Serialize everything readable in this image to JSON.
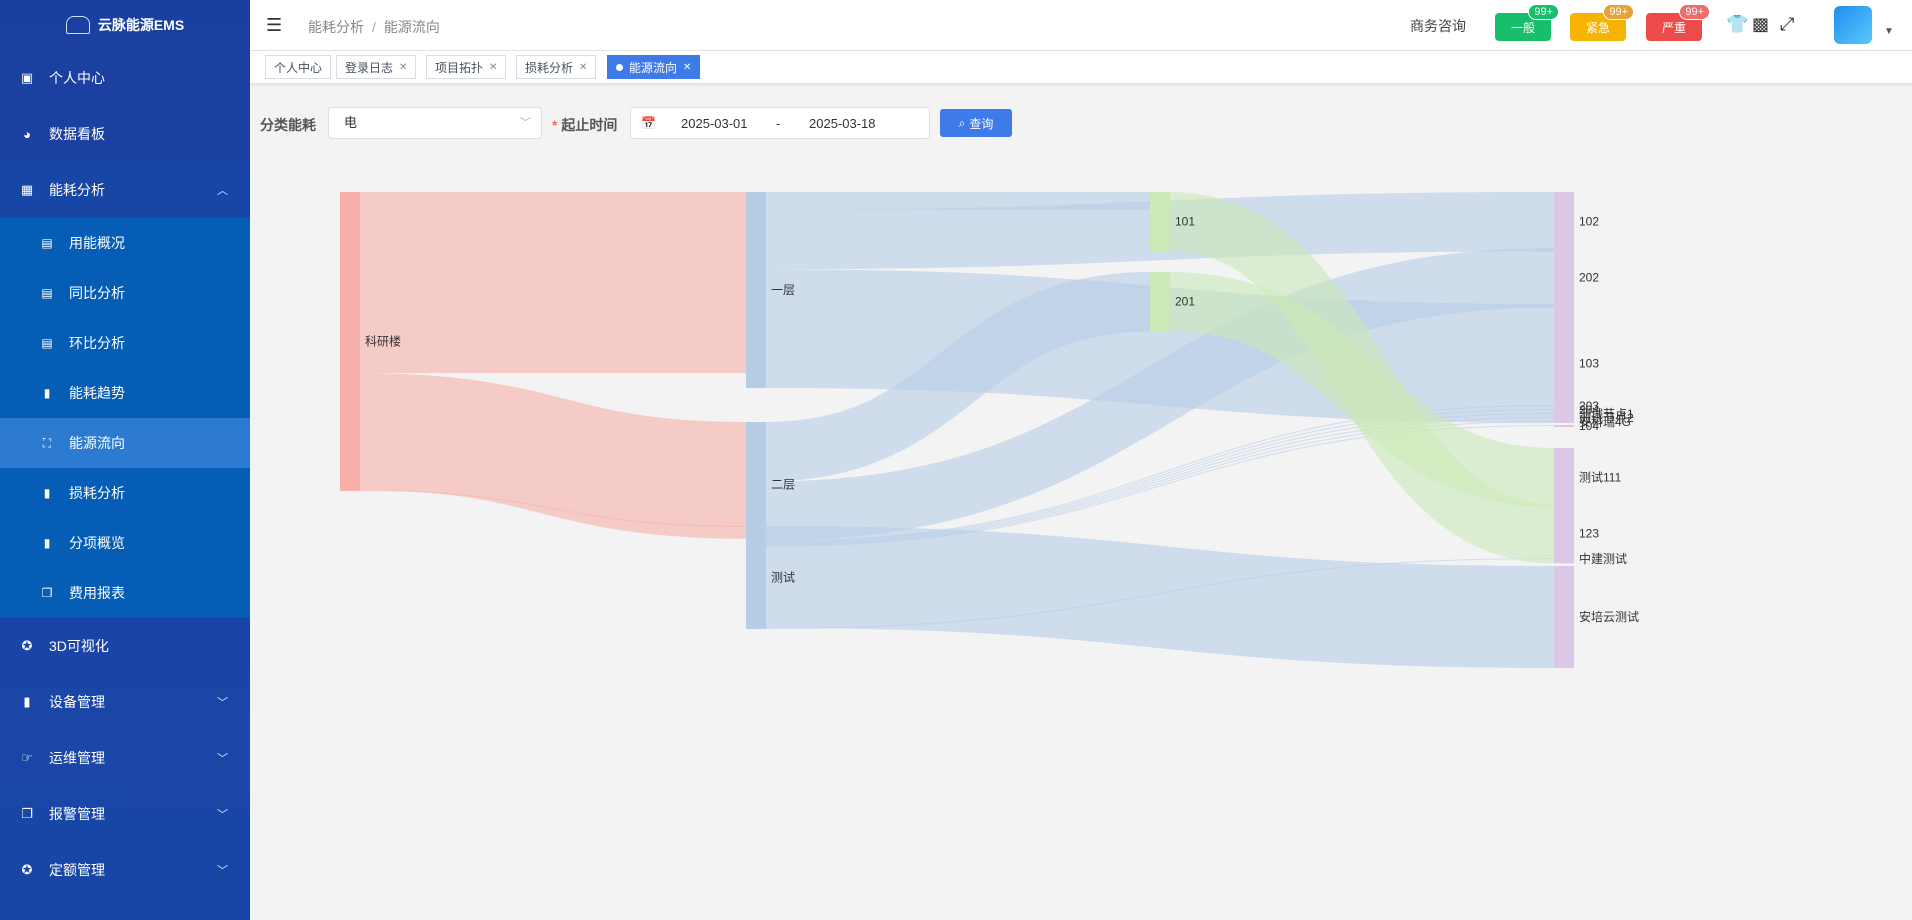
{
  "app": {
    "title": "云脉能源EMS"
  },
  "sidebar": {
    "items": [
      {
        "label": "个人中心",
        "icon": "user-card-icon"
      },
      {
        "label": "数据看板",
        "icon": "dashboard-icon"
      },
      {
        "label": "能耗分析",
        "icon": "table-icon",
        "open": true
      },
      {
        "label": "3D可视化",
        "icon": "cube-icon"
      },
      {
        "label": "设备管理",
        "icon": "bar-chart-icon"
      },
      {
        "label": "运维管理",
        "icon": "hand-icon"
      },
      {
        "label": "报警管理",
        "icon": "copy-icon"
      },
      {
        "label": "定额管理",
        "icon": "target-icon"
      }
    ],
    "sub_items": [
      {
        "label": "用能概况",
        "icon": "grid-icon"
      },
      {
        "label": "同比分析",
        "icon": "grid-icon"
      },
      {
        "label": "环比分析",
        "icon": "grid-icon"
      },
      {
        "label": "能耗趋势",
        "icon": "bar-chart-icon"
      },
      {
        "label": "能源流向",
        "icon": "tree-icon",
        "active": true
      },
      {
        "label": "损耗分析",
        "icon": "bar-chart-icon"
      },
      {
        "label": "分项概览",
        "icon": "bar-chart-icon"
      },
      {
        "label": "费用报表",
        "icon": "copy-icon"
      }
    ]
  },
  "header": {
    "breadcrumb": [
      "能耗分析",
      "能源流向"
    ],
    "consult": "商务咨询",
    "alarms": [
      {
        "label": "一般",
        "count": "99+",
        "color": "#19be6b"
      },
      {
        "label": "紧急",
        "count": "99+",
        "color": "#f6b400"
      },
      {
        "label": "严重",
        "count": "99+",
        "color": "#ed4a4a"
      }
    ]
  },
  "tags": [
    {
      "label": "个人中心",
      "closable": false
    },
    {
      "label": "登录日志",
      "closable": true
    },
    {
      "label": "项目拓扑",
      "closable": true
    },
    {
      "label": "损耗分析",
      "closable": true
    },
    {
      "label": "能源流向",
      "closable": true,
      "active": true
    }
  ],
  "filter": {
    "category_label": "分类能耗",
    "category_value": "电",
    "time_label": "起止时间",
    "required_mark": "*",
    "date_start": "2025-03-01",
    "date_sep": "-",
    "date_end": "2025-03-18",
    "query_label": "查询"
  },
  "chart_data": {
    "type": "sankey",
    "nodes": [
      {
        "name": "科研楼",
        "color": "#f7b0a9"
      },
      {
        "name": "一层",
        "color": "#b7cde6"
      },
      {
        "name": "二层",
        "color": "#b7cde6"
      },
      {
        "name": "测试",
        "color": "#b7cde6"
      },
      {
        "name": "101",
        "color": "#cbeab8"
      },
      {
        "name": "201",
        "color": "#cbeab8"
      },
      {
        "name": "102",
        "color": "#dcc8e6"
      },
      {
        "name": "202",
        "color": "#dcc8e6"
      },
      {
        "name": "103",
        "color": "#dcc8e6"
      },
      {
        "name": "203",
        "color": "#dcc8e6"
      },
      {
        "name": "204",
        "color": "#dcc8e6"
      },
      {
        "name": "测试节点1",
        "color": "#dcc8e6"
      },
      {
        "name": "测试节点2",
        "color": "#dcc8e6"
      },
      {
        "name": "安科瑞4G",
        "color": "#dcc8e6"
      },
      {
        "name": "104",
        "color": "#dcc8e6"
      },
      {
        "name": "测试111",
        "color": "#dcc8e6"
      },
      {
        "name": "123",
        "color": "#dcc8e6"
      },
      {
        "name": "中建测试",
        "color": "#dcc8e6"
      },
      {
        "name": "安培云测试",
        "color": "#dcc8e6"
      }
    ],
    "links": [
      {
        "source": "科研楼",
        "target": "一层",
        "value": 183
      },
      {
        "source": "科研楼",
        "target": "二层",
        "value": 118
      },
      {
        "source": "科研楼",
        "target": "测试",
        "value": 1
      },
      {
        "source": "一层",
        "target": "101",
        "value": 18
      },
      {
        "source": "一层",
        "target": "102",
        "value": 60
      },
      {
        "source": "一层",
        "target": "103",
        "value": 120
      },
      {
        "source": "二层",
        "target": "201",
        "value": 60
      },
      {
        "source": "二层",
        "target": "202",
        "value": 60
      },
      {
        "source": "二层",
        "target": "203",
        "value": 1
      },
      {
        "source": "二层",
        "target": "204",
        "value": 1
      },
      {
        "source": "二层",
        "target": "测试节点1",
        "value": 1
      },
      {
        "source": "二层",
        "target": "测试节点2",
        "value": 1
      },
      {
        "source": "二层",
        "target": "安科瑞4G",
        "value": 1
      },
      {
        "source": "二层",
        "target": "104",
        "value": 1
      },
      {
        "source": "测试",
        "target": "安培云测试",
        "value": 103
      },
      {
        "source": "测试",
        "target": "中建测试",
        "value": 1
      },
      {
        "source": "101",
        "target": "123",
        "value": 60
      },
      {
        "source": "201",
        "target": "测试111",
        "value": 60
      }
    ]
  }
}
